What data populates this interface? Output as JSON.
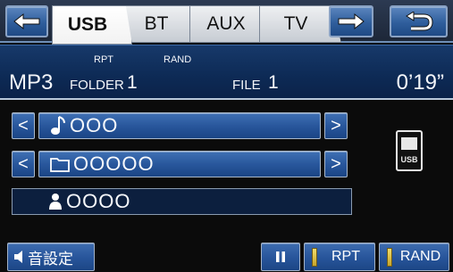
{
  "tabs": [
    {
      "label": "USB",
      "active": true
    },
    {
      "label": "BT",
      "active": false
    },
    {
      "label": "AUX",
      "active": false
    },
    {
      "label": "TV",
      "active": false
    }
  ],
  "nav": {
    "back_icon": "arrow-left-icon",
    "forward_icon": "arrow-right-icon",
    "return_icon": "return-arrow-icon"
  },
  "info": {
    "format": "MP3",
    "rpt_label": "RPT",
    "rand_label": "RAND",
    "folder_label": "FOLDER",
    "folder_num": "1",
    "file_label": "FILE",
    "file_num": "1",
    "elapsed": "0’19”"
  },
  "rows": {
    "track": {
      "icon": "music-note-icon",
      "text": "OOO"
    },
    "folder": {
      "icon": "folder-icon",
      "text": "OOOOO"
    },
    "artist": {
      "icon": "person-icon",
      "text": "OOOO"
    }
  },
  "device": {
    "label": "USB",
    "icon": "usb-device-icon"
  },
  "bottom": {
    "sound_label": "音設定",
    "pause_icon": "pause-icon",
    "rpt_label": "RPT",
    "rand_label": "RAND"
  },
  "colors": {
    "accent_blue": "#2f5e9c",
    "indicator_yellow": "#f3dd6b",
    "panel_dark": "#0b2249"
  }
}
